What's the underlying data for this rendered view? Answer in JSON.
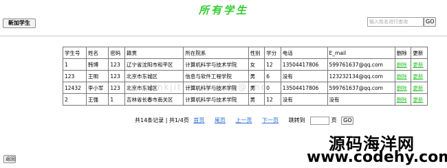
{
  "header": {
    "title": "所有学生"
  },
  "toolbar": {
    "add_label": "新加学生"
  },
  "search": {
    "placeholder": "输入姓名进行查询",
    "go_label": "GO"
  },
  "table": {
    "headers": [
      "学生号",
      "姓名",
      "密码",
      "籍贯",
      "所在院系",
      "性别",
      "学分",
      "电话",
      "E_mail",
      "删除",
      "更新"
    ],
    "rows": [
      [
        "1",
        "韩博",
        "123",
        "辽宁省沈阳市和平区",
        "计算机科学与技术学院",
        "女",
        "12",
        "13504417806",
        "599761637@qq.com",
        "删除",
        "更新"
      ],
      [
        "123",
        "王明",
        "123",
        "北京市东城区",
        "信息与软件工程学院",
        "男",
        "6",
        "没有",
        "123232134@qq.com",
        "删除",
        "更新"
      ],
      [
        "12432",
        "李小军",
        "123",
        "北京市东城区",
        "计算机科学与技术学院",
        "男",
        "0",
        "13504417806",
        "599761637@qq.com",
        "删除",
        "更新"
      ],
      [
        "2",
        "王强",
        "1",
        "吉林省长春市南关区",
        "计算机科学与技术学院",
        "男",
        "12",
        "没有",
        "没有",
        "删除",
        "更新"
      ]
    ]
  },
  "pager": {
    "summary": "共14条记录 | 共1/4页",
    "first": "首页",
    "last": "尾页",
    "prev": "上一页",
    "next": "下一页",
    "jump_label": "跳转到",
    "page_unit": "页",
    "go_label": "GO"
  },
  "footer": {
    "back_label": "返回"
  },
  "watermark": {
    "brand": "源码海洋网",
    "url": "www.codehy.com",
    "faint": "Jinkjitino W.@da@ mo"
  }
}
